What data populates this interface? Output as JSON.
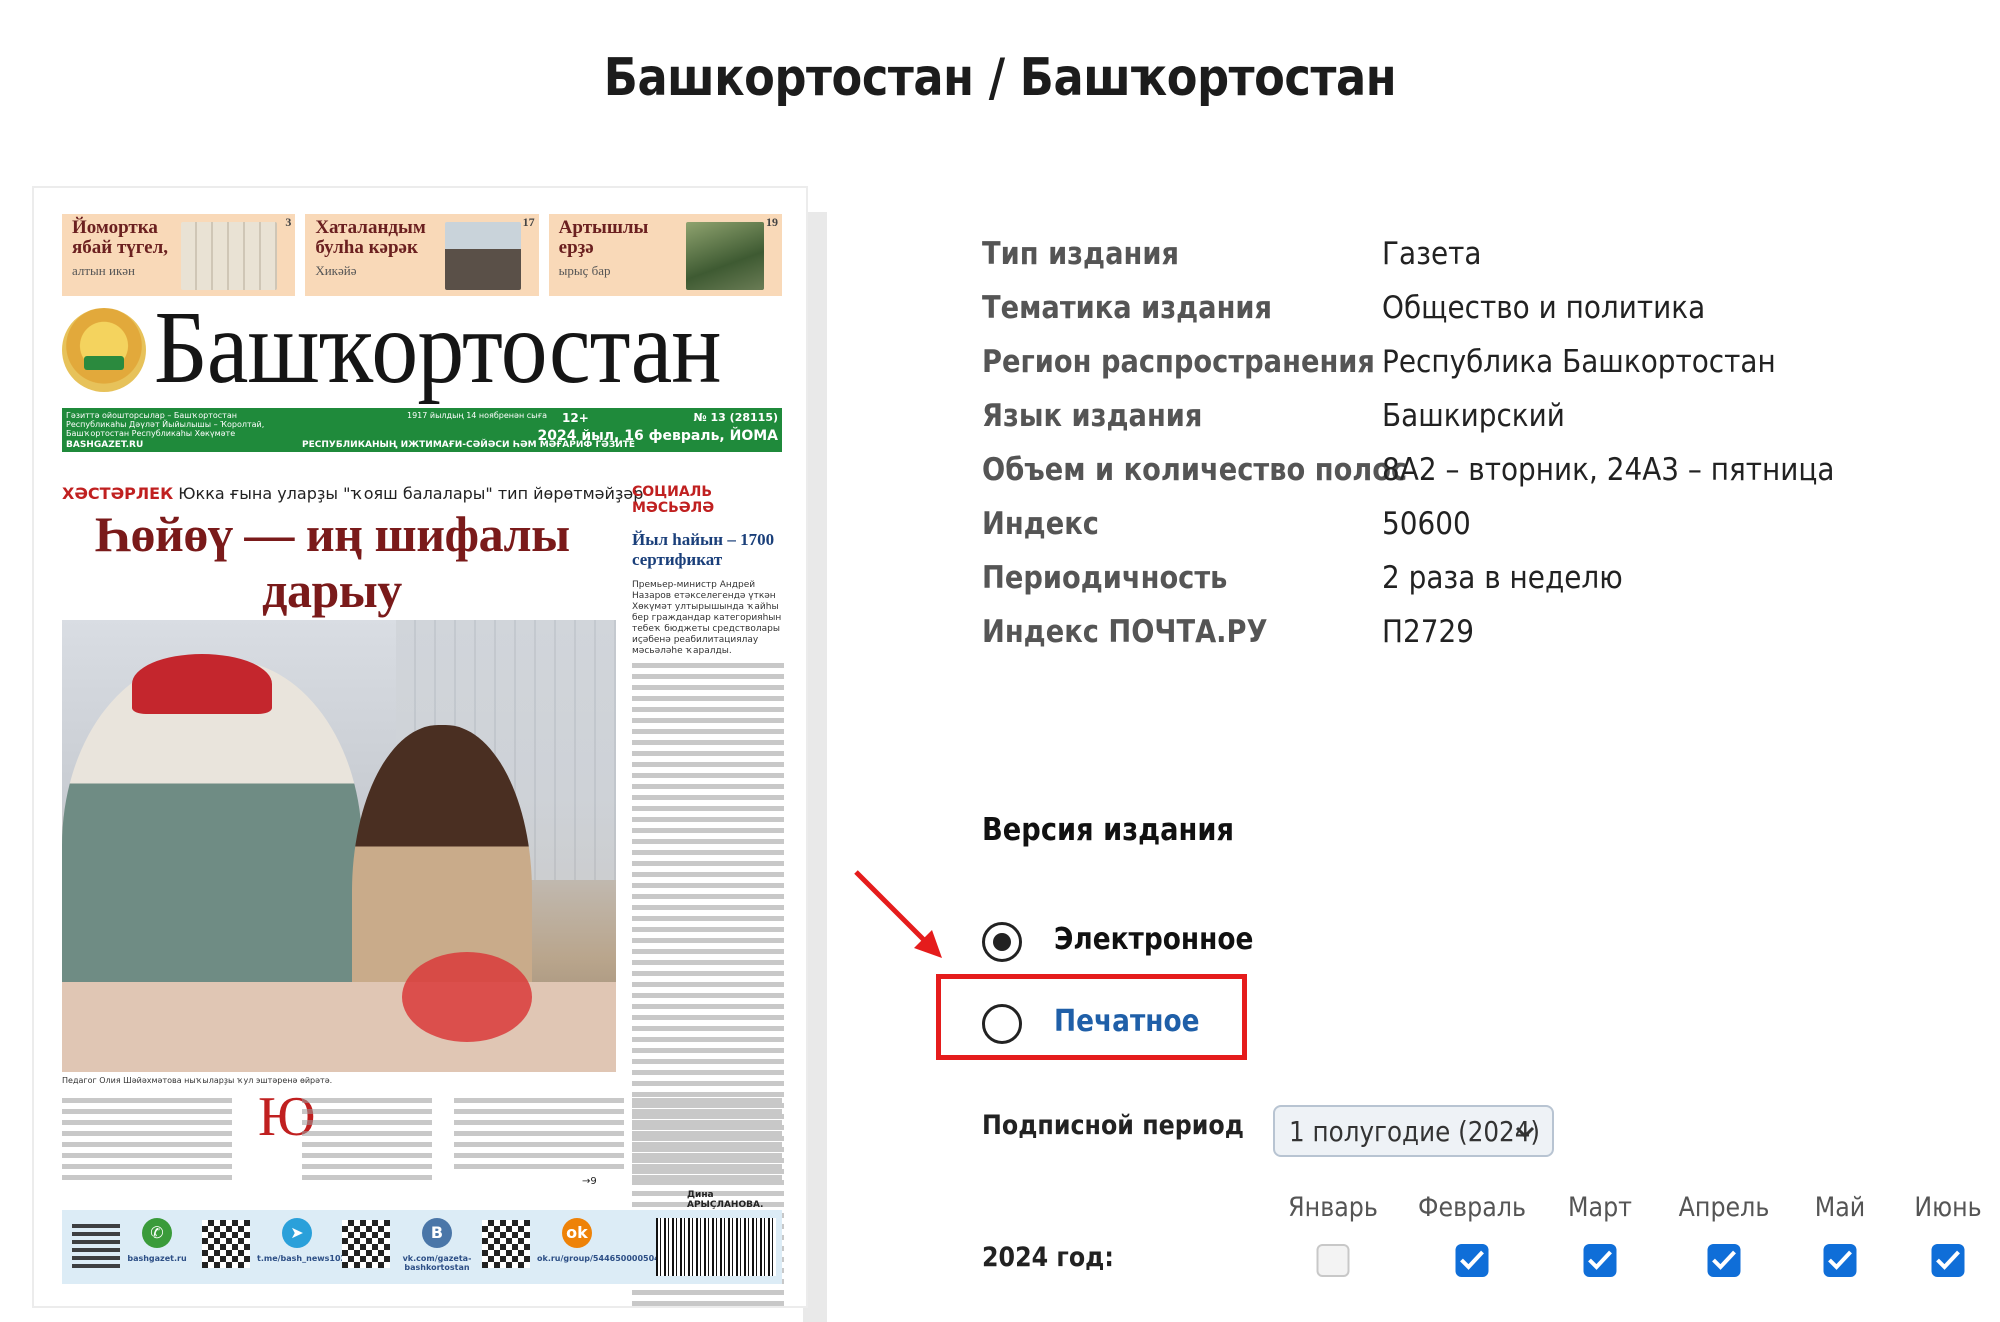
{
  "page": {
    "title": "Башкортостан / Башҡортостан"
  },
  "cover": {
    "teasers": [
      {
        "title": "Йомортка ябай түгел,",
        "sub": "алтын икән",
        "page": "3"
      },
      {
        "title": "Хаталандым булһа кәрәк",
        "sub": "Хикәйә",
        "page": "17"
      },
      {
        "title": "Артышлы ерҙә",
        "sub": "ырыҫ бар",
        "page": "19"
      }
    ],
    "masthead": "Башҡортостан",
    "green_bar": {
      "left_small": "Гәзиттә ойошторсылар – Башҡортостан Республикаһы Дәүләт Йыйылышы – Ҡоролтай, Башҡортостан Республикаһы Хөкүмәте",
      "site": "BASHGAZET.RU",
      "tagline": "РЕСПУБЛИКАНЫҢ ИЖТИМАҒИ-СӘЙӘСИ ҺӘМ МӘҒАРИФ ГӘЗИТЕ",
      "since": "1917 йылдың 14 ноябренән сыға",
      "age": "12+",
      "issue": "№ 13 (28115)",
      "date": "2024 йыл, 16 февраль, ЙОМА"
    },
    "rubric_label": "ХӘСТӘРЛЕК",
    "rubric_text": "Юкка ғына уларҙы \"ҡояш балалары\" тип йөрөтмәйҙәр",
    "headline": "Һөйөү — иң шифалы дарыу",
    "side_rubric": "СОЦИАЛЬ МӘСЬӘЛӘ",
    "side_headline": "Йыл һайын – 1700 сертификат",
    "side_lead": "Премьер-министр Андрей Назаров етәкселегендә үткән Хөкүмәт ултырышында ҡайһы бер граждандар категорияһын тебеҡ бюджеты средстволары иҫәбенә реабилитациялау мәсьәләһе ҡаралды.",
    "caption": "Педагог Олия Шәйәхмәтова ныҡыларҙы ҡул эштәренә өйрәтә.",
    "drop_cap": "Ю",
    "author": "Дина АРЫҪЛАНОВА.",
    "continue_mark": "→9",
    "bottom_links": [
      {
        "label": "bashgazet.ru",
        "icon": "phone-icon"
      },
      {
        "label": "t.me/bash_news102",
        "icon": "telegram-icon"
      },
      {
        "label": "vk.com/gazeta-bashkortostan",
        "icon": "vk-icon"
      },
      {
        "label": "ok.ru/group/54465000050413",
        "icon": "ok-icon"
      }
    ]
  },
  "info": [
    {
      "key": "Тип издания",
      "value": "Газета"
    },
    {
      "key": "Тематика издания",
      "value": "Общество и политика"
    },
    {
      "key": "Регион распространения",
      "value": "Республика Башкортостан"
    },
    {
      "key": "Язык издания",
      "value": "Башкирский"
    },
    {
      "key": "Объем и количество полос",
      "value": "8А2 – вторник, 24А3 – пятница"
    },
    {
      "key": "Индекс",
      "value": "50600"
    },
    {
      "key": "Периодичность",
      "value": "2 раза в неделю"
    },
    {
      "key": "Индекс ПОЧТА.РУ",
      "value": "П2729"
    }
  ],
  "version": {
    "title": "Версия издания",
    "options": [
      {
        "label": "Электронное",
        "selected": true
      },
      {
        "label": "Печатное",
        "selected": false
      }
    ],
    "highlighted": "Печатное"
  },
  "subscription": {
    "period_label": "Подписной период",
    "period_value": "1 полугодие (2024)",
    "year_label": "2024 год:",
    "months": [
      {
        "name": "Январь",
        "checked": false
      },
      {
        "name": "Февраль",
        "checked": true
      },
      {
        "name": "Март",
        "checked": true
      },
      {
        "name": "Апрель",
        "checked": true
      },
      {
        "name": "Май",
        "checked": true
      },
      {
        "name": "Июнь",
        "checked": true
      }
    ]
  },
  "colors": {
    "accent": "#0f6ed8",
    "highlight": "#e51c1c",
    "link": "#1f5fa8",
    "newspaper_green": "#1f8a3b"
  }
}
